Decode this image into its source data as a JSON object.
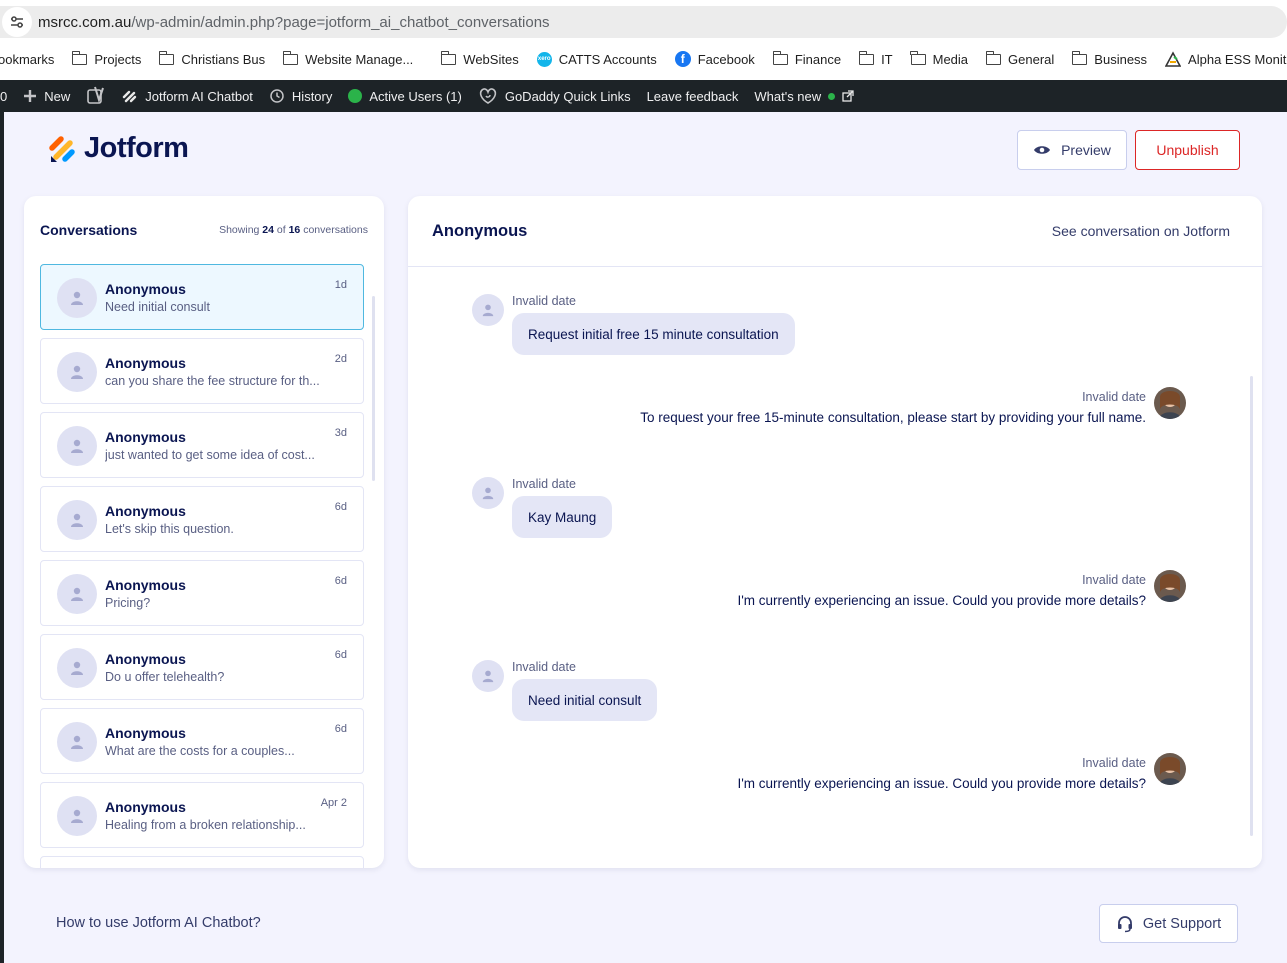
{
  "browser": {
    "url_host": "msrcc.com.au",
    "url_path": "/wp-admin/admin.php?page=jotform_ai_chatbot_conversations",
    "bookmarks": [
      {
        "label": "ookmarks",
        "icon": "none"
      },
      {
        "label": "Projects",
        "icon": "folder-icon"
      },
      {
        "label": "Christians Bus",
        "icon": "folder-icon"
      },
      {
        "label": "Website Manage...",
        "icon": "folder-icon"
      },
      {
        "label": "WebSites",
        "icon": "folder-icon"
      },
      {
        "label": "CATTS Accounts",
        "icon": "xero-icon"
      },
      {
        "label": "Facebook",
        "icon": "facebook-icon"
      },
      {
        "label": "Finance",
        "icon": "folder-icon"
      },
      {
        "label": "IT",
        "icon": "folder-icon"
      },
      {
        "label": "Media",
        "icon": "folder-icon"
      },
      {
        "label": "General",
        "icon": "folder-icon"
      },
      {
        "label": "Business",
        "icon": "folder-icon"
      },
      {
        "label": "Alpha ESS Monitor...",
        "icon": "alpha-ess-icon"
      }
    ]
  },
  "adminbar": {
    "count": "0",
    "new_label": "New",
    "chatbot_label": "Jotform AI Chatbot",
    "history_label": "History",
    "active_users_label": "Active Users (1)",
    "godaddy_label": "GoDaddy Quick Links",
    "feedback_label": "Leave feedback",
    "whats_new_label": "What's new"
  },
  "header": {
    "logo_text": "Jotform",
    "preview_label": "Preview",
    "unpublish_label": "Unpublish"
  },
  "conversations": {
    "title": "Conversations",
    "count_prefix": "Showing",
    "count_shown": "24",
    "count_of": "of",
    "count_total": "16",
    "count_suffix": "conversations",
    "items": [
      {
        "name": "Anonymous",
        "preview": "Need initial consult",
        "time": "1d"
      },
      {
        "name": "Anonymous",
        "preview": "can you share the fee structure for th...",
        "time": "2d"
      },
      {
        "name": "Anonymous",
        "preview": "just wanted to get some idea of cost...",
        "time": "3d"
      },
      {
        "name": "Anonymous",
        "preview": "Let's skip this question.",
        "time": "6d"
      },
      {
        "name": "Anonymous",
        "preview": "Pricing?",
        "time": "6d"
      },
      {
        "name": "Anonymous",
        "preview": "Do u offer telehealth?",
        "time": "6d"
      },
      {
        "name": "Anonymous",
        "preview": "What are the costs for a couples...",
        "time": "6d"
      },
      {
        "name": "Anonymous",
        "preview": "Healing from a broken relationship...",
        "time": "Apr 2"
      },
      {
        "name": "",
        "preview": "",
        "time": ""
      }
    ]
  },
  "chat": {
    "title": "Anonymous",
    "see_link": "See conversation on Jotform",
    "messages": [
      {
        "from": "user",
        "date": "Invalid date",
        "text": "Request initial free 15 minute consultation"
      },
      {
        "from": "bot",
        "date": "Invalid date",
        "text": "To request your free 15-minute consultation, please start by providing your full name."
      },
      {
        "from": "user",
        "date": "Invalid date",
        "text": "Kay Maung"
      },
      {
        "from": "bot",
        "date": "Invalid date",
        "text": "I'm currently experiencing an issue. Could you provide more details?"
      },
      {
        "from": "user",
        "date": "Invalid date",
        "text": "Need initial consult"
      },
      {
        "from": "bot",
        "date": "Invalid date",
        "text": "I'm currently experiencing an issue. Could you provide more details?"
      }
    ]
  },
  "footer": {
    "help_link": "How to use Jotform AI Chatbot?",
    "support_label": "Get Support"
  },
  "colors": {
    "brand_navy": "#0a1551",
    "page_bg": "#f3f3fe",
    "active_item_bg": "#edf8ff",
    "active_item_border": "#4fb8e0",
    "unpublish_red": "#dc2626",
    "bubble_bg": "#e4e6f6",
    "adminbar_bg": "#1d2327"
  }
}
